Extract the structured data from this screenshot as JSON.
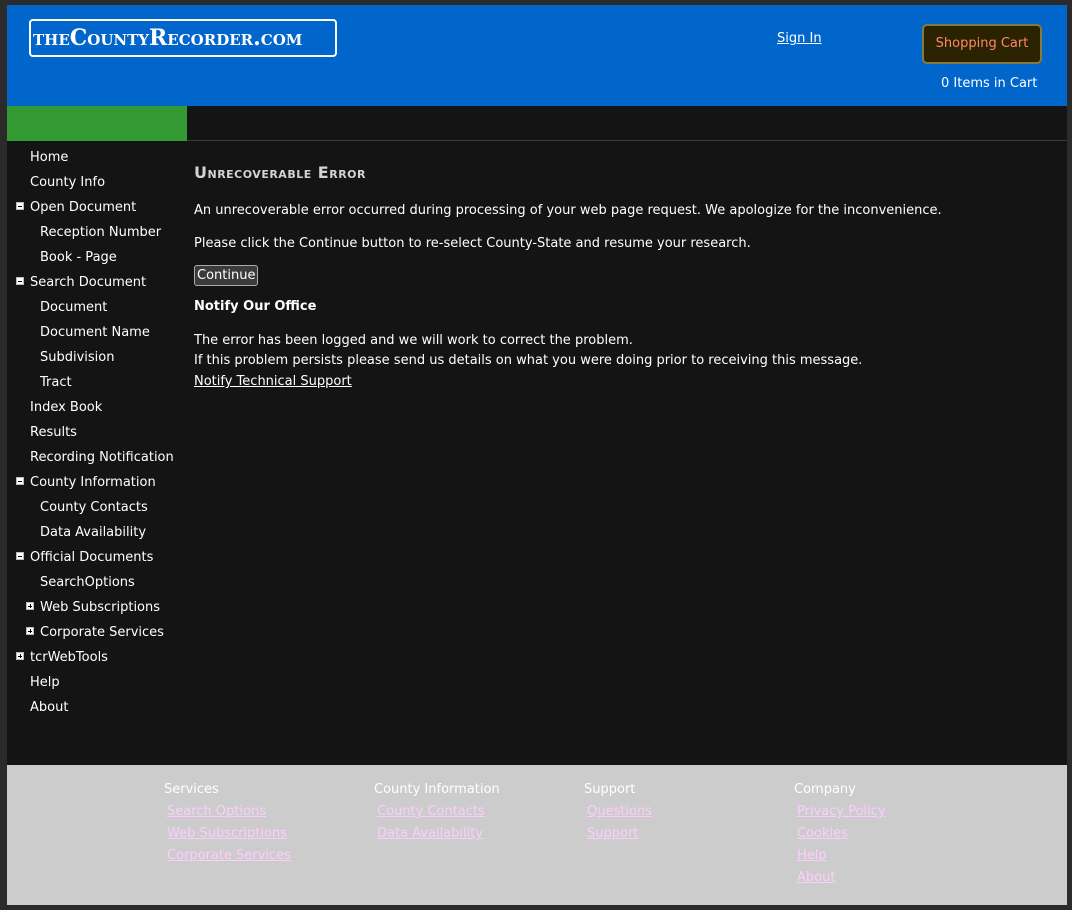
{
  "header": {
    "logo_text": "theCountyRecorder.com",
    "sign_in": "Sign In",
    "cart_button": "Shopping Cart",
    "cart_count": "0 Items in Cart"
  },
  "sidebar": {
    "items": [
      {
        "label": "Home"
      },
      {
        "label": "County Info"
      },
      {
        "label": "Open Document"
      },
      {
        "label": "Reception Number"
      },
      {
        "label": "Book - Page"
      },
      {
        "label": "Search Document"
      },
      {
        "label": "Document"
      },
      {
        "label": "Document Name"
      },
      {
        "label": "Subdivision"
      },
      {
        "label": "Tract"
      },
      {
        "label": "Index Book"
      },
      {
        "label": "Results"
      },
      {
        "label": "Recording Notification"
      },
      {
        "label": "County Information"
      },
      {
        "label": "County Contacts"
      },
      {
        "label": "Data Availability"
      },
      {
        "label": "Official Documents"
      },
      {
        "label": "SearchOptions"
      },
      {
        "label": "Web Subscriptions"
      },
      {
        "label": "Corporate Services"
      },
      {
        "label": "tcrWebTools"
      },
      {
        "label": "Help"
      },
      {
        "label": "About"
      }
    ]
  },
  "main": {
    "title": "Unrecoverable Error",
    "message1": "An unrecoverable error occurred during processing of your web page request. We apologize for the inconvenience.",
    "message2": "Please click the Continue button to re-select County-State and resume your research.",
    "continue_button": "Continue",
    "notify_heading": "Notify Our Office",
    "logged_text": "The error has been logged and we will work to correct the problem.",
    "persists_text": "If this problem persists please send us details on what you were doing prior to receiving this message.",
    "notify_link": "Notify Technical Support"
  },
  "footer": {
    "columns": [
      {
        "heading": "Services",
        "links": [
          "Search Options",
          "Web Subscriptions",
          "Corporate Services"
        ]
      },
      {
        "heading": "County Information",
        "links": [
          "County Contacts",
          "Data Availability"
        ]
      },
      {
        "heading": "Support",
        "links": [
          "Questions",
          "Support"
        ]
      },
      {
        "heading": "Company",
        "links": [
          "Privacy Policy",
          "Cookies",
          "Help",
          "About"
        ]
      }
    ]
  },
  "colors": {
    "header_bg": "#0066cc",
    "accent_green": "#339933",
    "page_bg": "#141414",
    "footer_bg": "#cccccc",
    "footer_link": "#ffccff",
    "cart_text": "#ff8a65"
  }
}
